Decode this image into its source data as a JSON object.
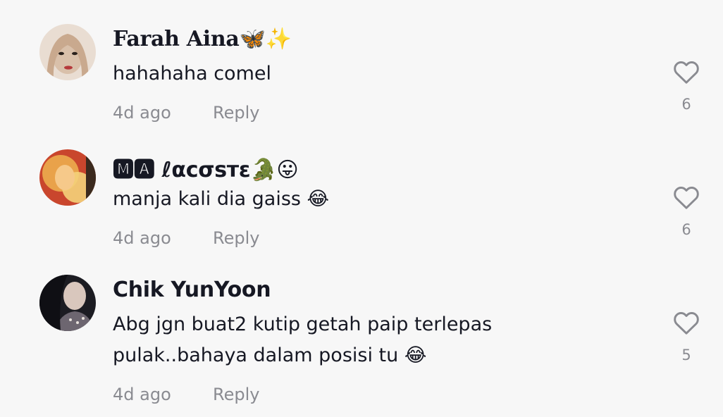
{
  "comments": [
    {
      "author": "Farah Aina🦋✨",
      "text_lines": [
        "hahahaha comel"
      ],
      "time": "4d ago",
      "reply_label": "Reply",
      "likes": "6",
      "avatar_palette": [
        "#e9ddd2",
        "#c9a98e",
        "#2a211c"
      ]
    },
    {
      "author": "🅼🅰 ℓαcσѕтε🐊😛",
      "text_lines": [
        "manja kali dia gaiss 😂"
      ],
      "time": "4d ago",
      "reply_label": "Reply",
      "likes": "6",
      "avatar_palette": [
        "#e9a24a",
        "#c9462d",
        "#f4d27a"
      ]
    },
    {
      "author": "Chik YunYoon",
      "text_lines": [
        "Abg jgn buat2 kutip getah paip terlepas",
        "pulak..bahaya dalam posisi tu 😂"
      ],
      "time": "4d ago",
      "reply_label": "Reply",
      "likes": "5",
      "avatar_palette": [
        "#1c1c22",
        "#d9c7bd",
        "#6d6670"
      ]
    }
  ],
  "icons": {
    "like": "heart-outline-icon"
  },
  "colors": {
    "background": "#f7f7f7",
    "text": "#161823",
    "muted": "#8a8b91"
  }
}
